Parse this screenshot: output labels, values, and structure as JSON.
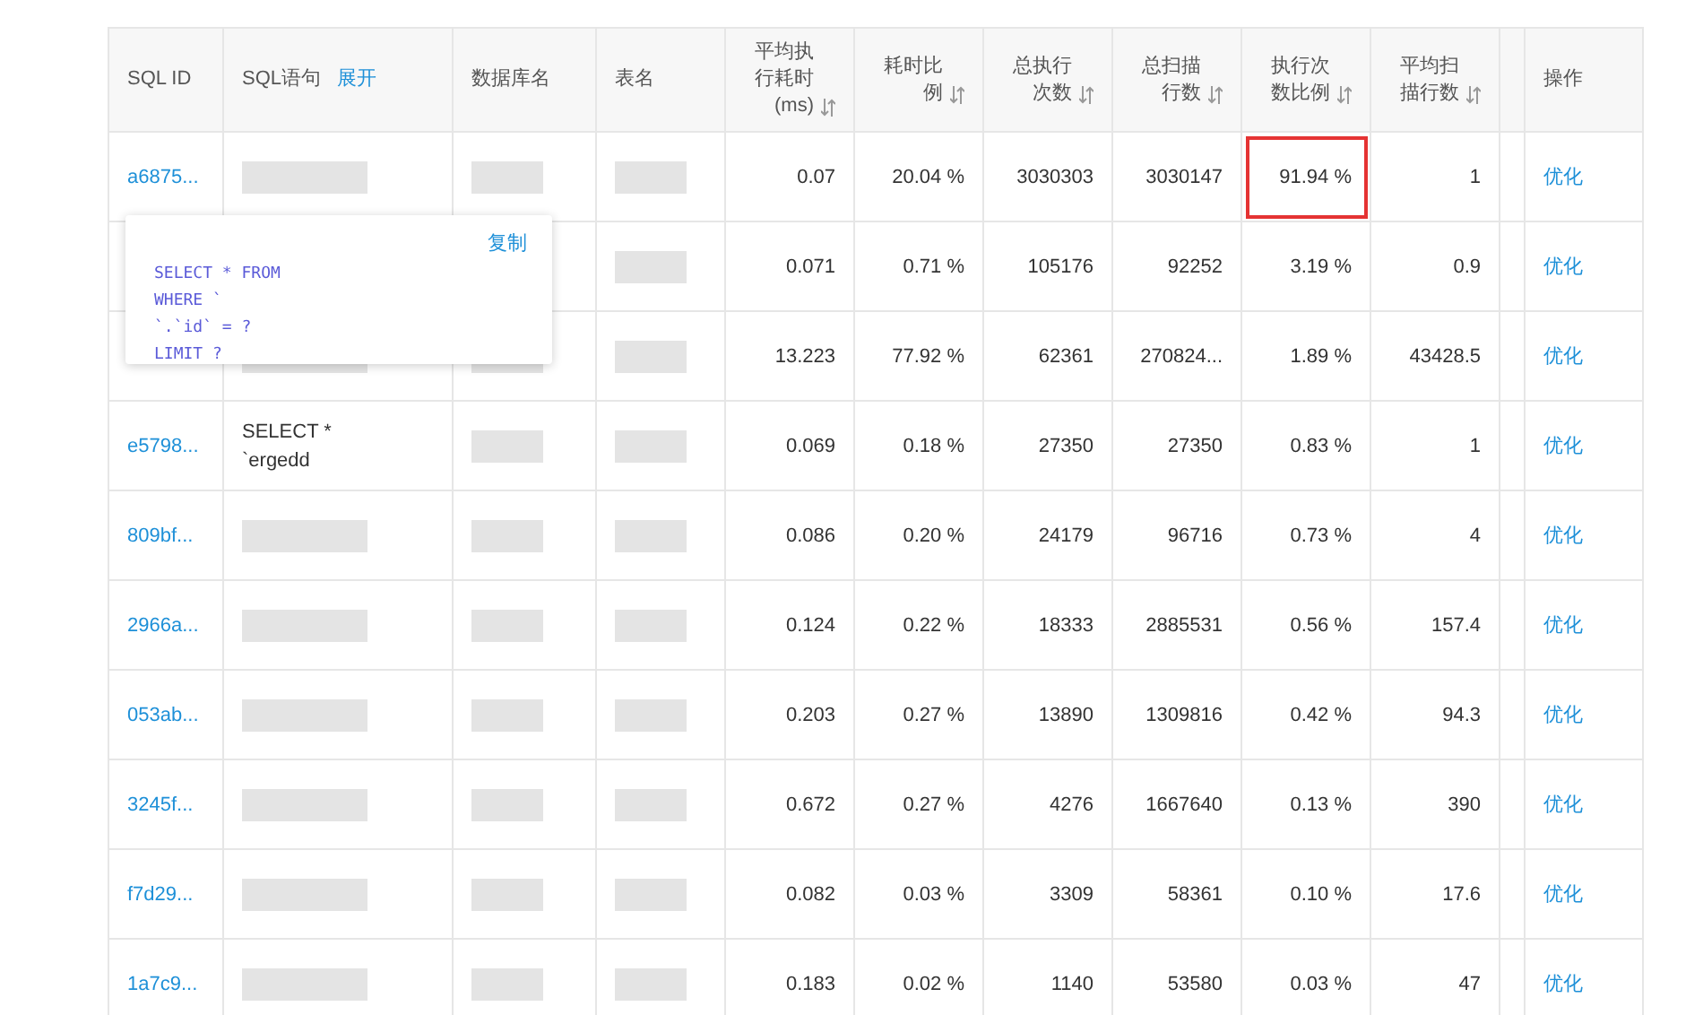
{
  "table": {
    "columns": [
      {
        "label": "SQL ID",
        "kind": "text"
      },
      {
        "label": "SQL语句",
        "kind": "expand",
        "action": "展开"
      },
      {
        "label": "数据库名",
        "kind": "text"
      },
      {
        "label": "表名",
        "kind": "text"
      },
      {
        "label": "平均执行耗时(ms)",
        "kind": "sort"
      },
      {
        "label": "耗时比例",
        "kind": "sort"
      },
      {
        "label": "总执行次数",
        "kind": "sort"
      },
      {
        "label": "总扫描行数",
        "kind": "sort"
      },
      {
        "label": "执行次数比例",
        "kind": "sort"
      },
      {
        "label": "平均扫描行数",
        "kind": "sort"
      },
      {
        "kind": "spacer"
      },
      {
        "label": "操作",
        "kind": "text"
      }
    ],
    "rows": [
      {
        "id": "a6875...",
        "sql_lines": [],
        "avg_time": "0.07",
        "time_ratio": "20.04 %",
        "exec_count": "3030303",
        "scan_rows": "3030147",
        "exec_ratio": "91.94 %",
        "highlighted": true,
        "avg_scan": "1",
        "action": "优化"
      },
      {
        "id": "",
        "sql_lines": [],
        "avg_time": "0.071",
        "time_ratio": "0.71 %",
        "exec_count": "105176",
        "scan_rows": "92252",
        "exec_ratio": "3.19 %",
        "highlighted": false,
        "avg_scan": "0.9",
        "action": "优化"
      },
      {
        "id": "",
        "sql_lines": [],
        "avg_time": "13.223",
        "time_ratio": "77.92 %",
        "exec_count": "62361",
        "scan_rows": "270824...",
        "exec_ratio": "1.89 %",
        "highlighted": false,
        "avg_scan": "43428.5",
        "action": "优化"
      },
      {
        "id": "e5798...",
        "sql_lines": [
          "SELECT *",
          "`ergedd"
        ],
        "avg_time": "0.069",
        "time_ratio": "0.18 %",
        "exec_count": "27350",
        "scan_rows": "27350",
        "exec_ratio": "0.83 %",
        "highlighted": false,
        "avg_scan": "1",
        "action": "优化"
      },
      {
        "id": "809bf...",
        "sql_lines": [],
        "avg_time": "0.086",
        "time_ratio": "0.20 %",
        "exec_count": "24179",
        "scan_rows": "96716",
        "exec_ratio": "0.73 %",
        "highlighted": false,
        "avg_scan": "4",
        "action": "优化"
      },
      {
        "id": "2966a...",
        "sql_lines": [],
        "avg_time": "0.124",
        "time_ratio": "0.22 %",
        "exec_count": "18333",
        "scan_rows": "2885531",
        "exec_ratio": "0.56 %",
        "highlighted": false,
        "avg_scan": "157.4",
        "action": "优化"
      },
      {
        "id": "053ab...",
        "sql_lines": [],
        "avg_time": "0.203",
        "time_ratio": "0.27 %",
        "exec_count": "13890",
        "scan_rows": "1309816",
        "exec_ratio": "0.42 %",
        "highlighted": false,
        "avg_scan": "94.3",
        "action": "优化"
      },
      {
        "id": "3245f...",
        "sql_lines": [],
        "avg_time": "0.672",
        "time_ratio": "0.27 %",
        "exec_count": "4276",
        "scan_rows": "1667640",
        "exec_ratio": "0.13 %",
        "highlighted": false,
        "avg_scan": "390",
        "action": "优化"
      },
      {
        "id": "f7d29...",
        "sql_lines": [],
        "avg_time": "0.082",
        "time_ratio": "0.03 %",
        "exec_count": "3309",
        "scan_rows": "58361",
        "exec_ratio": "0.10 %",
        "highlighted": false,
        "avg_scan": "17.6",
        "action": "优化"
      },
      {
        "id": "1a7c9...",
        "sql_lines": [],
        "avg_time": "0.183",
        "time_ratio": "0.02 %",
        "exec_count": "1140",
        "scan_rows": "53580",
        "exec_ratio": "0.03 %",
        "highlighted": false,
        "avg_scan": "47",
        "action": "优化"
      }
    ]
  },
  "popover": {
    "copy": "复制",
    "code_lines": [
      "SELECT * FROM",
      "WHERE `",
      "`.`id` = ?",
      "LIMIT ?"
    ]
  }
}
